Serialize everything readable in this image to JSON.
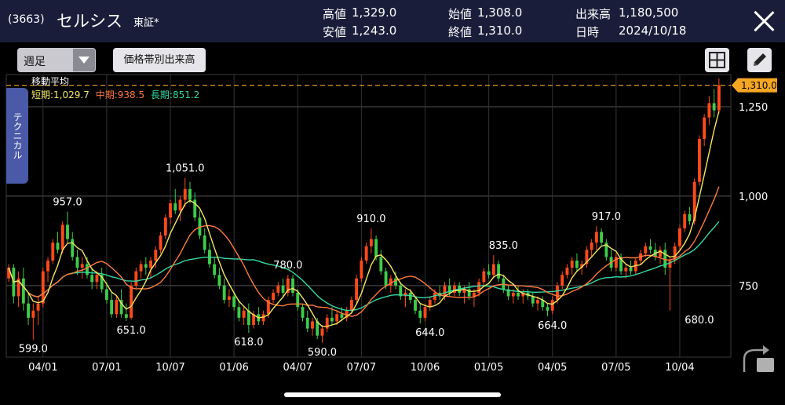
{
  "header": {
    "code": "(3663)",
    "name": "セルシス",
    "exchange": "東証*",
    "high_label": "高値",
    "high_value": "1,329.0",
    "low_label": "安値",
    "low_value": "1,243.0",
    "open_label": "始値",
    "open_value": "1,308.0",
    "close_label": "終値",
    "close_value": "1,310.0",
    "volume_label": "出来高",
    "volume_value": "1,180,500",
    "date_label": "日時",
    "date_value": "2024/10/18"
  },
  "toolbar": {
    "period_select": "週足",
    "volume_by_price_button": "価格帯別出来高"
  },
  "side_tab": "テクニカル",
  "ma_legend": {
    "title": "移動平均",
    "short": "短期:1,029.7",
    "mid": "中期:938.5",
    "long": "長期:851.2"
  },
  "colors": {
    "up": "#ff4a1a",
    "down": "#3ecb4a",
    "ma_short": "#f5e663",
    "ma_mid": "#ff7a3d",
    "ma_long": "#35d8a6",
    "price_line": "#f5a623",
    "header_bg": "#1a1d3a",
    "side_tab_bg": "#4a5aa8"
  },
  "chart_data": {
    "type": "candlestick",
    "y_ticks": [
      "1,250",
      "1,000",
      "750"
    ],
    "ylim": [
      550,
      1340
    ],
    "x_ticks": [
      "04/01",
      "07/01",
      "10/07",
      "01/06",
      "04/07",
      "07/07",
      "10/06",
      "01/05",
      "04/05",
      "07/05",
      "10/04"
    ],
    "current_price_label": "1,310.0",
    "current_price": 1310,
    "annotations": [
      {
        "label": "599.0",
        "value": 599,
        "index": 5
      },
      {
        "label": "957.0",
        "value": 957,
        "index": 12
      },
      {
        "label": "651.0",
        "value": 651,
        "index": 25
      },
      {
        "label": "1,051.0",
        "value": 1051,
        "index": 36
      },
      {
        "label": "618.0",
        "value": 618,
        "index": 49
      },
      {
        "label": "780.0",
        "value": 780,
        "index": 57
      },
      {
        "label": "590.0",
        "value": 590,
        "index": 64
      },
      {
        "label": "910.0",
        "value": 910,
        "index": 74
      },
      {
        "label": "644.0",
        "value": 644,
        "index": 86
      },
      {
        "label": "835.0",
        "value": 835,
        "index": 101
      },
      {
        "label": "664.0",
        "value": 664,
        "index": 111
      },
      {
        "label": "917.0",
        "value": 917,
        "index": 122
      },
      {
        "label": "680.0",
        "value": 680,
        "index": 141
      }
    ],
    "candles": [
      [
        770,
        810,
        760,
        800
      ],
      [
        800,
        810,
        700,
        720
      ],
      [
        720,
        790,
        690,
        770
      ],
      [
        770,
        800,
        680,
        700
      ],
      [
        700,
        730,
        640,
        660
      ],
      [
        660,
        700,
        599,
        680
      ],
      [
        680,
        720,
        640,
        700
      ],
      [
        700,
        800,
        690,
        790
      ],
      [
        790,
        830,
        760,
        820
      ],
      [
        820,
        880,
        810,
        870
      ],
      [
        870,
        900,
        840,
        850
      ],
      [
        850,
        930,
        840,
        920
      ],
      [
        920,
        957,
        870,
        880
      ],
      [
        880,
        900,
        820,
        830
      ],
      [
        830,
        850,
        780,
        800
      ],
      [
        800,
        830,
        770,
        810
      ],
      [
        810,
        830,
        770,
        780
      ],
      [
        780,
        800,
        740,
        760
      ],
      [
        760,
        790,
        740,
        780
      ],
      [
        780,
        800,
        730,
        740
      ],
      [
        740,
        760,
        700,
        710
      ],
      [
        710,
        730,
        660,
        670
      ],
      [
        670,
        720,
        660,
        710
      ],
      [
        710,
        740,
        660,
        670
      ],
      [
        670,
        700,
        651,
        660
      ],
      [
        660,
        760,
        655,
        750
      ],
      [
        750,
        800,
        740,
        790
      ],
      [
        790,
        820,
        770,
        810
      ],
      [
        810,
        830,
        780,
        800
      ],
      [
        800,
        830,
        770,
        820
      ],
      [
        820,
        860,
        800,
        850
      ],
      [
        850,
        900,
        840,
        890
      ],
      [
        890,
        950,
        880,
        940
      ],
      [
        940,
        990,
        920,
        980
      ],
      [
        980,
        1020,
        950,
        960
      ],
      [
        960,
        1000,
        930,
        990
      ],
      [
        990,
        1051,
        970,
        1020
      ],
      [
        1020,
        1040,
        980,
        990
      ],
      [
        990,
        1010,
        930,
        940
      ],
      [
        940,
        960,
        880,
        890
      ],
      [
        890,
        910,
        840,
        850
      ],
      [
        850,
        870,
        800,
        810
      ],
      [
        810,
        830,
        770,
        780
      ],
      [
        780,
        800,
        740,
        750
      ],
      [
        750,
        770,
        700,
        710
      ],
      [
        710,
        740,
        690,
        720
      ],
      [
        720,
        730,
        680,
        690
      ],
      [
        690,
        710,
        650,
        660
      ],
      [
        660,
        690,
        640,
        680
      ],
      [
        680,
        700,
        618,
        640
      ],
      [
        640,
        680,
        630,
        670
      ],
      [
        670,
        690,
        640,
        650
      ],
      [
        650,
        680,
        640,
        670
      ],
      [
        670,
        720,
        660,
        710
      ],
      [
        710,
        740,
        700,
        730
      ],
      [
        730,
        760,
        720,
        750
      ],
      [
        750,
        770,
        720,
        730
      ],
      [
        730,
        780,
        720,
        770
      ],
      [
        770,
        780,
        720,
        730
      ],
      [
        730,
        740,
        680,
        690
      ],
      [
        690,
        700,
        650,
        660
      ],
      [
        660,
        680,
        620,
        630
      ],
      [
        630,
        660,
        610,
        650
      ],
      [
        650,
        660,
        600,
        610
      ],
      [
        610,
        640,
        590,
        630
      ],
      [
        630,
        670,
        620,
        660
      ],
      [
        660,
        690,
        640,
        650
      ],
      [
        650,
        680,
        640,
        670
      ],
      [
        670,
        690,
        650,
        660
      ],
      [
        660,
        690,
        650,
        680
      ],
      [
        680,
        720,
        670,
        710
      ],
      [
        710,
        780,
        700,
        770
      ],
      [
        770,
        830,
        760,
        820
      ],
      [
        820,
        870,
        810,
        860
      ],
      [
        860,
        910,
        840,
        880
      ],
      [
        880,
        890,
        820,
        830
      ],
      [
        830,
        850,
        780,
        790
      ],
      [
        790,
        800,
        740,
        750
      ],
      [
        750,
        780,
        730,
        770
      ],
      [
        770,
        790,
        740,
        750
      ],
      [
        750,
        760,
        710,
        720
      ],
      [
        720,
        740,
        690,
        730
      ],
      [
        730,
        740,
        700,
        710
      ],
      [
        710,
        720,
        670,
        680
      ],
      [
        680,
        700,
        644,
        660
      ],
      [
        660,
        700,
        650,
        690
      ],
      [
        690,
        720,
        680,
        710
      ],
      [
        710,
        740,
        700,
        730
      ],
      [
        730,
        750,
        710,
        720
      ],
      [
        720,
        760,
        710,
        750
      ],
      [
        750,
        770,
        720,
        730
      ],
      [
        730,
        760,
        720,
        750
      ],
      [
        750,
        760,
        720,
        730
      ],
      [
        730,
        750,
        700,
        740
      ],
      [
        740,
        760,
        710,
        720
      ],
      [
        720,
        740,
        690,
        730
      ],
      [
        730,
        770,
        720,
        760
      ],
      [
        760,
        800,
        750,
        790
      ],
      [
        790,
        810,
        770,
        780
      ],
      [
        780,
        835,
        770,
        810
      ],
      [
        810,
        820,
        760,
        770
      ],
      [
        770,
        780,
        730,
        740
      ],
      [
        740,
        750,
        710,
        720
      ],
      [
        720,
        740,
        700,
        730
      ],
      [
        730,
        750,
        710,
        720
      ],
      [
        720,
        740,
        700,
        730
      ],
      [
        730,
        740,
        710,
        720
      ],
      [
        720,
        730,
        690,
        700
      ],
      [
        700,
        720,
        680,
        710
      ],
      [
        710,
        720,
        680,
        690
      ],
      [
        690,
        700,
        664,
        680
      ],
      [
        680,
        720,
        670,
        710
      ],
      [
        710,
        760,
        700,
        750
      ],
      [
        750,
        790,
        740,
        780
      ],
      [
        780,
        810,
        770,
        800
      ],
      [
        800,
        830,
        780,
        820
      ],
      [
        820,
        840,
        790,
        800
      ],
      [
        800,
        820,
        780,
        810
      ],
      [
        810,
        860,
        800,
        850
      ],
      [
        850,
        880,
        830,
        870
      ],
      [
        870,
        917,
        850,
        900
      ],
      [
        900,
        910,
        860,
        870
      ],
      [
        870,
        880,
        820,
        830
      ],
      [
        830,
        850,
        790,
        800
      ],
      [
        800,
        840,
        790,
        830
      ],
      [
        830,
        840,
        780,
        790
      ],
      [
        790,
        810,
        770,
        800
      ],
      [
        800,
        820,
        780,
        790
      ],
      [
        790,
        830,
        780,
        820
      ],
      [
        820,
        850,
        810,
        840
      ],
      [
        840,
        870,
        830,
        860
      ],
      [
        860,
        880,
        840,
        850
      ],
      [
        850,
        870,
        820,
        830
      ],
      [
        830,
        860,
        810,
        850
      ],
      [
        850,
        870,
        780,
        800
      ],
      [
        800,
        830,
        680,
        820
      ],
      [
        820,
        870,
        810,
        860
      ],
      [
        860,
        920,
        850,
        910
      ],
      [
        910,
        960,
        900,
        950
      ],
      [
        950,
        970,
        920,
        930
      ],
      [
        930,
        1050,
        920,
        1040
      ],
      [
        1040,
        1170,
        1030,
        1160
      ],
      [
        1160,
        1230,
        1140,
        1220
      ],
      [
        1220,
        1280,
        1200,
        1260
      ],
      [
        1260,
        1300,
        1220,
        1240
      ],
      [
        1240,
        1329,
        1230,
        1310
      ]
    ]
  }
}
